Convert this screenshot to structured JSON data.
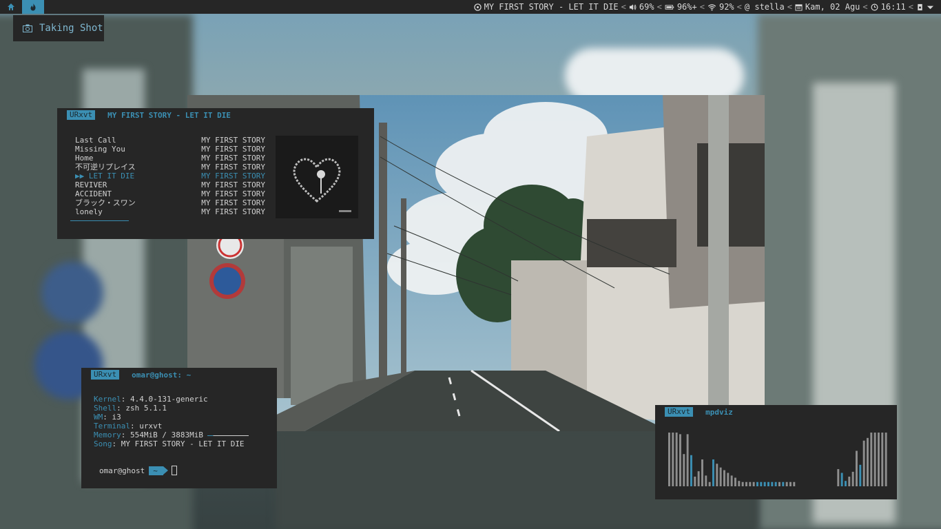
{
  "topbar": {
    "workspaces": [
      {
        "icon": "home-icon",
        "active": false
      },
      {
        "icon": "fire-icon",
        "active": true
      }
    ],
    "now_playing": "MY FIRST STORY - LET IT DIE",
    "volume": "69%",
    "battery": "96%+",
    "wifi": "92%",
    "host": "@ stella",
    "date": "Kam, 02 Agu",
    "time": "16:11"
  },
  "notification": {
    "icon": "camera-icon",
    "text": "Taking Shot"
  },
  "music_terminal": {
    "tag": "URxvt",
    "title": "MY FIRST STORY - LET IT DIE",
    "playlist": [
      {
        "title": "Last Call",
        "artist": "MY FIRST STORY",
        "current": false
      },
      {
        "title": "Missing You",
        "artist": "MY FIRST STORY",
        "current": false
      },
      {
        "title": "Home",
        "artist": "MY FIRST STORY",
        "current": false
      },
      {
        "title": "不可逆リプレイス",
        "artist": "MY FIRST STORY",
        "current": false
      },
      {
        "title": "▶▶ LET IT DIE",
        "artist": "MY FIRST STORY",
        "current": true
      },
      {
        "title": "REVIVER",
        "artist": "MY FIRST STORY",
        "current": false
      },
      {
        "title": "ACCIDENT",
        "artist": "MY FIRST STORY",
        "current": false
      },
      {
        "title": "ブラック・スワン",
        "artist": "MY FIRST STORY",
        "current": false
      },
      {
        "title": "lonely",
        "artist": "MY FIRST STORY",
        "current": false
      }
    ],
    "progress": 0.2
  },
  "fetch_terminal": {
    "tag": "URxvt",
    "title": "omar@ghost: ~",
    "info": [
      {
        "key": "Kernel",
        "value": "4.4.0-131-generic"
      },
      {
        "key": "Shell",
        "value": "zsh 5.1.1"
      },
      {
        "key": "WM",
        "value": "i3"
      },
      {
        "key": "Terminal",
        "value": "urxvt"
      },
      {
        "key": "Memory",
        "value": "554MiB / 3883MiB"
      },
      {
        "key": "Song",
        "value": "MY FIRST STORY - LET IT DIE"
      }
    ],
    "memory_fraction": 0.14,
    "prompt_user": "omar@ghost",
    "prompt_dir": "~"
  },
  "viz_terminal": {
    "tag": "URxvt",
    "title": "mpdviz",
    "bars": [
      1.0,
      1.0,
      1.0,
      0.97,
      0.6,
      0.97,
      0.58,
      0.18,
      0.28,
      0.5,
      0.2,
      0.08,
      0.5,
      0.42,
      0.35,
      0.3,
      0.25,
      0.2,
      0.16,
      0.1,
      0.08,
      0.08,
      0.08,
      0.08,
      0.08,
      0.08,
      0.08,
      0.08,
      0.08,
      0.08,
      0.08,
      0.08,
      0.08,
      0.08,
      0.08,
      0.0,
      0.0,
      0.0,
      0.0,
      0.0,
      0.0,
      0.0,
      0.0,
      0.0,
      0.0,
      0.0,
      0.32,
      0.25,
      0.1,
      0.18,
      0.27,
      0.66,
      0.4,
      0.85,
      0.9,
      1.0,
      1.0,
      1.0,
      1.0,
      1.0
    ],
    "highlight": [
      6,
      12,
      24,
      25,
      26,
      27,
      28,
      29,
      31,
      47,
      48,
      52
    ],
    "colors": {
      "bar": "#8e8e8e",
      "highlight": "#3b8fb3"
    }
  },
  "colors": {
    "accent": "#3b8fb3",
    "panel": "#262626"
  }
}
